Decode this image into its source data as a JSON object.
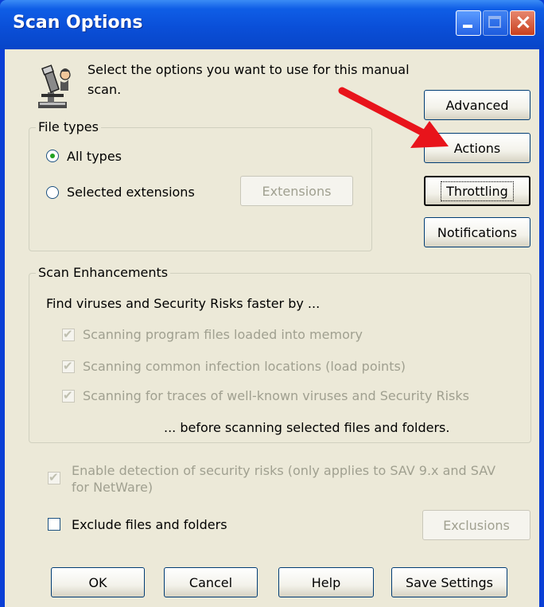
{
  "window": {
    "title": "Scan Options"
  },
  "intro": {
    "text_line1": "Select the options you want to use for this manual",
    "text_line2": "scan."
  },
  "file_types": {
    "legend": "File types",
    "all_types_label": "All types",
    "selected_ext_label": "Selected extensions",
    "extensions_button": "Extensions"
  },
  "side_buttons": {
    "advanced": "Advanced",
    "actions": "Actions",
    "throttling": "Throttling",
    "notifications": "Notifications"
  },
  "scan_enhancements": {
    "legend": "Scan Enhancements",
    "intro": "Find viruses and Security Risks faster by ...",
    "items": [
      "Scanning program files loaded into memory",
      "Scanning common infection locations (load points)",
      "Scanning for traces of well-known viruses and Security Risks"
    ],
    "footer": "... before scanning selected files and folders."
  },
  "security_risks": {
    "label_line1": "Enable detection of security risks (only applies to SAV 9.x and SAV",
    "label_line2": "for NetWare)"
  },
  "exclude": {
    "label": "Exclude files and folders",
    "exclusions_button": "Exclusions"
  },
  "footer_buttons": {
    "ok": "OK",
    "cancel": "Cancel",
    "help": "Help",
    "save": "Save Settings"
  },
  "colors": {
    "title_bar": "#0a4fd8",
    "arrow": "#e8141b",
    "face": "#ece9d8"
  }
}
